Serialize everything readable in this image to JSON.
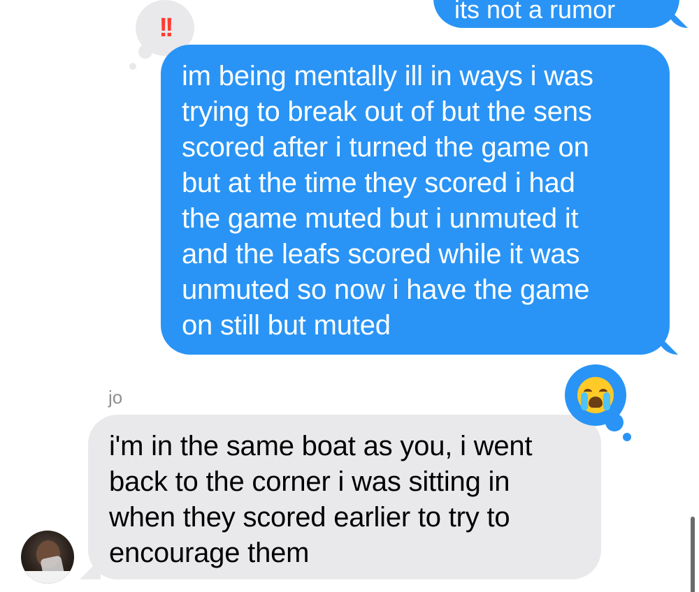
{
  "messages": {
    "previous_outgoing": {
      "text": "its not a rumor"
    },
    "outgoing": {
      "text": "im being mentally ill in ways i was\ntrying to break out of but the sens\nscored after i turned the game on\nbut at the time they scored i had\nthe game muted but i unmuted it\nand the leafs scored while it was\nunmuted so now i have the game\non still but muted",
      "reaction": "!!"
    },
    "incoming": {
      "sender": "jo",
      "text": "i'm in the same boat as you, i went\nback to the corner i was sitting in\nwhen they scored earlier to try to\nencourage them",
      "reaction_icon": "crying-face-icon"
    }
  },
  "colors": {
    "outgoing_bubble": "#2994f5",
    "incoming_bubble": "#e9e9eb",
    "emphasis_reaction": "#ff3b30",
    "sender_name": "#8e8e93"
  }
}
